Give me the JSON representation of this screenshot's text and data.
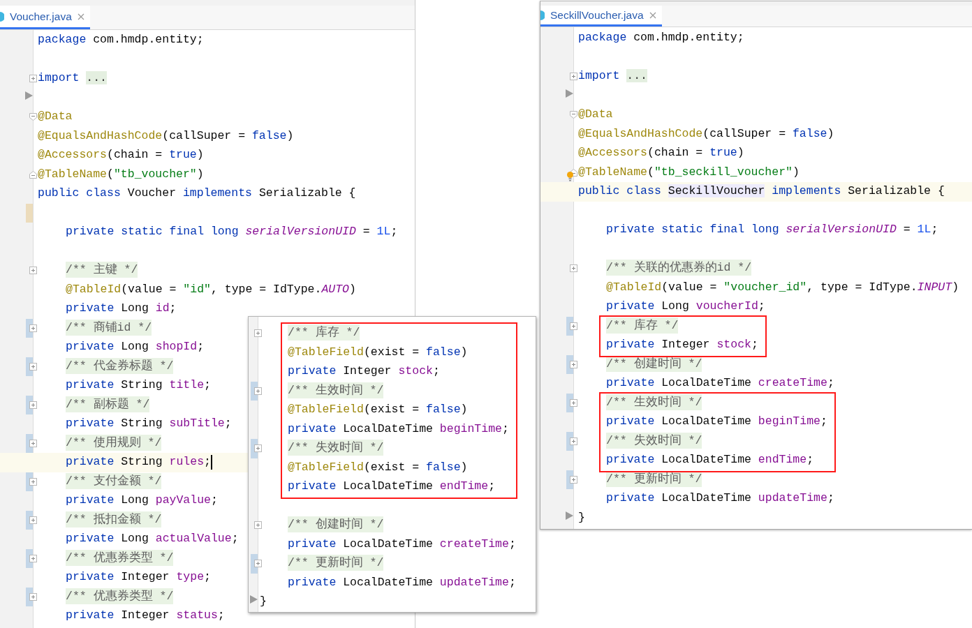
{
  "panels": [
    {
      "kind": "editor",
      "tab": {
        "label": "Voucher.java",
        "selected": true
      },
      "header_lines": [
        {
          "kind": "code",
          "tokens": [
            {
              "kind": "keyword",
              "text": "package"
            },
            {
              "kind": "plain",
              "text": " com.hmdp.entity;"
            }
          ]
        },
        {
          "kind": "blank"
        },
        {
          "kind": "code",
          "collapsed": true,
          "tokens": [
            {
              "kind": "keyword",
              "text": "import "
            },
            {
              "kind": "folded",
              "text": "..."
            }
          ]
        },
        {
          "kind": "blank",
          "arrow": true
        },
        {
          "kind": "code",
          "fold_start": true,
          "tokens": [
            {
              "kind": "annotation",
              "text": "@Data"
            }
          ]
        },
        {
          "kind": "code",
          "tokens": [
            {
              "kind": "annotation",
              "text": "@EqualsAndHashCode"
            },
            {
              "kind": "plain",
              "text": "(callSuper = "
            },
            {
              "kind": "keyword",
              "text": "false"
            },
            {
              "kind": "plain",
              "text": ")"
            }
          ]
        },
        {
          "kind": "code",
          "tokens": [
            {
              "kind": "annotation",
              "text": "@Accessors"
            },
            {
              "kind": "plain",
              "text": "(chain = "
            },
            {
              "kind": "keyword",
              "text": "true"
            },
            {
              "kind": "plain",
              "text": ")"
            }
          ]
        },
        {
          "kind": "code",
          "fold_end": true,
          "tokens": [
            {
              "kind": "annotation",
              "text": "@TableName"
            },
            {
              "kind": "plain",
              "text": "("
            },
            {
              "kind": "string",
              "text": "\"tb_voucher\""
            },
            {
              "kind": "plain",
              "text": ")"
            }
          ]
        },
        {
          "kind": "code",
          "tokens": [
            {
              "kind": "keyword",
              "text": "public class"
            },
            {
              "kind": "plain",
              "text": " Voucher "
            },
            {
              "kind": "keyword",
              "text": "implements"
            },
            {
              "kind": "plain",
              "text": " Serializable {"
            }
          ]
        }
      ],
      "body_lines": [
        {
          "kind": "blank",
          "unsaved": true
        },
        {
          "kind": "code",
          "tokens": [
            {
              "kind": "keyword",
              "text": "private static final long "
            },
            {
              "kind": "static",
              "text": "serialVersionUID"
            },
            {
              "kind": "plain",
              "text": " = "
            },
            {
              "kind": "number",
              "text": "1L"
            },
            {
              "kind": "plain",
              "text": ";"
            }
          ]
        },
        {
          "kind": "blank"
        },
        {
          "kind": "code",
          "collapsed": true,
          "tokens": [
            {
              "kind": "comment",
              "text": "/** 主键 */"
            }
          ]
        },
        {
          "kind": "code",
          "tokens": [
            {
              "kind": "annotation",
              "text": "@TableId"
            },
            {
              "kind": "plain",
              "text": "(value = "
            },
            {
              "kind": "string",
              "text": "\"id\""
            },
            {
              "kind": "plain",
              "text": ", type = IdType."
            },
            {
              "kind": "static",
              "text": "AUTO"
            },
            {
              "kind": "plain",
              "text": ")"
            }
          ]
        },
        {
          "kind": "code",
          "tokens": [
            {
              "kind": "keyword",
              "text": "private"
            },
            {
              "kind": "plain",
              "text": " Long "
            },
            {
              "kind": "field",
              "text": "id"
            },
            {
              "kind": "plain",
              "text": ";"
            }
          ]
        },
        {
          "kind": "code",
          "collapsed": true,
          "changed": true,
          "tokens": [
            {
              "kind": "comment",
              "text": "/** 商铺id */"
            }
          ]
        },
        {
          "kind": "code",
          "tokens": [
            {
              "kind": "keyword",
              "text": "private"
            },
            {
              "kind": "plain",
              "text": " Long "
            },
            {
              "kind": "field",
              "text": "shopId"
            },
            {
              "kind": "plain",
              "text": ";"
            }
          ]
        },
        {
          "kind": "code",
          "collapsed": true,
          "changed": true,
          "tokens": [
            {
              "kind": "comment",
              "text": "/** 代金券标题 */"
            }
          ]
        },
        {
          "kind": "code",
          "tokens": [
            {
              "kind": "keyword",
              "text": "private"
            },
            {
              "kind": "plain",
              "text": " String "
            },
            {
              "kind": "field",
              "text": "title"
            },
            {
              "kind": "plain",
              "text": ";"
            }
          ]
        },
        {
          "kind": "code",
          "collapsed": true,
          "changed": true,
          "tokens": [
            {
              "kind": "comment",
              "text": "/** 副标题 */"
            }
          ]
        },
        {
          "kind": "code",
          "tokens": [
            {
              "kind": "keyword",
              "text": "private"
            },
            {
              "kind": "plain",
              "text": " String "
            },
            {
              "kind": "field",
              "text": "subTitle"
            },
            {
              "kind": "plain",
              "text": ";"
            }
          ]
        },
        {
          "kind": "code",
          "collapsed": true,
          "changed": true,
          "tokens": [
            {
              "kind": "comment",
              "text": "/** 使用规则 */"
            }
          ]
        },
        {
          "kind": "code",
          "current": true,
          "caret": true,
          "tokens": [
            {
              "kind": "keyword",
              "text": "private"
            },
            {
              "kind": "plain",
              "text": " String "
            },
            {
              "kind": "field",
              "text": "rules"
            },
            {
              "kind": "plain",
              "text": ";"
            }
          ]
        },
        {
          "kind": "code",
          "collapsed": true,
          "changed": true,
          "tokens": [
            {
              "kind": "comment",
              "text": "/** 支付金额 */"
            }
          ]
        },
        {
          "kind": "code",
          "tokens": [
            {
              "kind": "keyword",
              "text": "private"
            },
            {
              "kind": "plain",
              "text": " Long "
            },
            {
              "kind": "field",
              "text": "payValue"
            },
            {
              "kind": "plain",
              "text": ";"
            }
          ]
        },
        {
          "kind": "code",
          "collapsed": true,
          "changed": true,
          "tokens": [
            {
              "kind": "comment",
              "text": "/** 抵扣金额 */"
            }
          ]
        },
        {
          "kind": "code",
          "tokens": [
            {
              "kind": "keyword",
              "text": "private"
            },
            {
              "kind": "plain",
              "text": " Long "
            },
            {
              "kind": "field",
              "text": "actualValue"
            },
            {
              "kind": "plain",
              "text": ";"
            }
          ]
        },
        {
          "kind": "code",
          "collapsed": true,
          "changed": true,
          "tokens": [
            {
              "kind": "comment",
              "text": "/** 优惠券类型 */"
            }
          ]
        },
        {
          "kind": "code",
          "tokens": [
            {
              "kind": "keyword",
              "text": "private"
            },
            {
              "kind": "plain",
              "text": " Integer "
            },
            {
              "kind": "field",
              "text": "type"
            },
            {
              "kind": "plain",
              "text": ";"
            }
          ]
        },
        {
          "kind": "code",
          "collapsed": true,
          "changed": true,
          "tokens": [
            {
              "kind": "comment",
              "text": "/** 优惠券类型 */"
            }
          ]
        },
        {
          "kind": "code",
          "tokens": [
            {
              "kind": "keyword",
              "text": "private"
            },
            {
              "kind": "plain",
              "text": " Integer "
            },
            {
              "kind": "field",
              "text": "status"
            },
            {
              "kind": "plain",
              "text": ";"
            }
          ]
        }
      ]
    },
    {
      "kind": "popup",
      "body_lines": [
        {
          "kind": "highlight",
          "children": [
            {
              "kind": "code",
              "collapsed": true,
              "tokens": [
                {
                  "kind": "comment",
                  "text": "/** 库存 */"
                }
              ]
            },
            {
              "kind": "code",
              "tokens": [
                {
                  "kind": "annotation",
                  "text": "@TableField"
                },
                {
                  "kind": "plain",
                  "text": "(exist = "
                },
                {
                  "kind": "keyword",
                  "text": "false"
                },
                {
                  "kind": "plain",
                  "text": ")"
                }
              ]
            },
            {
              "kind": "code",
              "tokens": [
                {
                  "kind": "keyword",
                  "text": "private"
                },
                {
                  "kind": "plain",
                  "text": " Integer "
                },
                {
                  "kind": "field",
                  "text": "stock"
                },
                {
                  "kind": "plain",
                  "text": ";"
                }
              ]
            },
            {
              "kind": "code",
              "collapsed": true,
              "changed": true,
              "tokens": [
                {
                  "kind": "comment",
                  "text": "/** 生效时间 */"
                }
              ]
            },
            {
              "kind": "code",
              "tokens": [
                {
                  "kind": "annotation",
                  "text": "@TableField"
                },
                {
                  "kind": "plain",
                  "text": "(exist = "
                },
                {
                  "kind": "keyword",
                  "text": "false"
                },
                {
                  "kind": "plain",
                  "text": ")"
                }
              ]
            },
            {
              "kind": "code",
              "tokens": [
                {
                  "kind": "keyword",
                  "text": "private"
                },
                {
                  "kind": "plain",
                  "text": " LocalDateTime "
                },
                {
                  "kind": "field",
                  "text": "beginTime"
                },
                {
                  "kind": "plain",
                  "text": ";"
                }
              ]
            },
            {
              "kind": "code",
              "collapsed": true,
              "changed": true,
              "tokens": [
                {
                  "kind": "comment",
                  "text": "/** 失效时间 */"
                }
              ]
            },
            {
              "kind": "code",
              "tokens": [
                {
                  "kind": "annotation",
                  "text": "@TableField"
                },
                {
                  "kind": "plain",
                  "text": "(exist = "
                },
                {
                  "kind": "keyword",
                  "text": "false"
                },
                {
                  "kind": "plain",
                  "text": ")"
                }
              ]
            },
            {
              "kind": "code",
              "tokens": [
                {
                  "kind": "keyword",
                  "text": "private"
                },
                {
                  "kind": "plain",
                  "text": " LocalDateTime "
                },
                {
                  "kind": "field",
                  "text": "endTime"
                },
                {
                  "kind": "plain",
                  "text": ";"
                }
              ]
            }
          ]
        },
        {
          "kind": "blank"
        },
        {
          "kind": "code",
          "collapsed": true,
          "tokens": [
            {
              "kind": "comment",
              "text": "/** 创建时间 */"
            }
          ]
        },
        {
          "kind": "code",
          "tokens": [
            {
              "kind": "keyword",
              "text": "private"
            },
            {
              "kind": "plain",
              "text": " LocalDateTime "
            },
            {
              "kind": "field",
              "text": "createTime"
            },
            {
              "kind": "plain",
              "text": ";"
            }
          ]
        },
        {
          "kind": "code",
          "collapsed": true,
          "changed": true,
          "tokens": [
            {
              "kind": "comment",
              "text": "/** 更新时间 */"
            }
          ]
        },
        {
          "kind": "code",
          "tokens": [
            {
              "kind": "keyword",
              "text": "private"
            },
            {
              "kind": "plain",
              "text": " LocalDateTime "
            },
            {
              "kind": "field",
              "text": "updateTime"
            },
            {
              "kind": "plain",
              "text": ";"
            }
          ]
        }
      ],
      "footer_lines": [
        {
          "kind": "code",
          "arrow": true,
          "tokens": [
            {
              "kind": "plain",
              "text": "}"
            }
          ]
        }
      ]
    },
    {
      "kind": "editor",
      "tab": {
        "label": "SeckillVoucher.java",
        "selected": true
      },
      "header_lines": [
        {
          "kind": "code",
          "tokens": [
            {
              "kind": "keyword",
              "text": "package"
            },
            {
              "kind": "plain",
              "text": " com.hmdp.entity;"
            }
          ]
        },
        {
          "kind": "blank"
        },
        {
          "kind": "code",
          "collapsed": true,
          "tokens": [
            {
              "kind": "keyword",
              "text": "import "
            },
            {
              "kind": "folded",
              "text": "..."
            }
          ]
        },
        {
          "kind": "blank",
          "arrow": true
        },
        {
          "kind": "code",
          "fold_start": true,
          "tokens": [
            {
              "kind": "annotation",
              "text": "@Data"
            }
          ]
        },
        {
          "kind": "code",
          "tokens": [
            {
              "kind": "annotation",
              "text": "@EqualsAndHashCode"
            },
            {
              "kind": "plain",
              "text": "(callSuper = "
            },
            {
              "kind": "keyword",
              "text": "false"
            },
            {
              "kind": "plain",
              "text": ")"
            }
          ]
        },
        {
          "kind": "code",
          "tokens": [
            {
              "kind": "annotation",
              "text": "@Accessors"
            },
            {
              "kind": "plain",
              "text": "(chain = "
            },
            {
              "kind": "keyword",
              "text": "true"
            },
            {
              "kind": "plain",
              "text": ")"
            }
          ]
        },
        {
          "kind": "code",
          "fold_end": true,
          "bulb": true,
          "tokens": [
            {
              "kind": "annotation",
              "text": "@TableName"
            },
            {
              "kind": "plain",
              "text": "("
            },
            {
              "kind": "string",
              "text": "\"tb_seckill_voucher\""
            },
            {
              "kind": "plain",
              "text": ")"
            }
          ]
        },
        {
          "kind": "code",
          "current": true,
          "tokens": [
            {
              "kind": "keyword",
              "text": "public class "
            },
            {
              "kind": "class-ref",
              "text": "SeckillVoucher"
            },
            {
              "kind": "keyword",
              "text": " implements"
            },
            {
              "kind": "plain",
              "text": " Serializable {"
            }
          ]
        }
      ],
      "body_lines": [
        {
          "kind": "blank"
        },
        {
          "kind": "code",
          "tokens": [
            {
              "kind": "keyword",
              "text": "private static final long "
            },
            {
              "kind": "static",
              "text": "serialVersionUID"
            },
            {
              "kind": "plain",
              "text": " = "
            },
            {
              "kind": "number",
              "text": "1L"
            },
            {
              "kind": "plain",
              "text": ";"
            }
          ]
        },
        {
          "kind": "blank"
        },
        {
          "kind": "code",
          "collapsed": true,
          "tokens": [
            {
              "kind": "comment",
              "text": "/** 关联的优惠券的id */"
            }
          ]
        },
        {
          "kind": "code",
          "tokens": [
            {
              "kind": "annotation",
              "text": "@TableId"
            },
            {
              "kind": "plain",
              "text": "(value = "
            },
            {
              "kind": "string",
              "text": "\"voucher_id\""
            },
            {
              "kind": "plain",
              "text": ", type = IdType."
            },
            {
              "kind": "static",
              "text": "INPUT"
            },
            {
              "kind": "plain",
              "text": ")"
            }
          ]
        },
        {
          "kind": "code",
          "tokens": [
            {
              "kind": "keyword",
              "text": "private"
            },
            {
              "kind": "plain",
              "text": " Long "
            },
            {
              "kind": "field",
              "text": "voucherId"
            },
            {
              "kind": "plain",
              "text": ";"
            }
          ]
        },
        {
          "kind": "highlight",
          "children": [
            {
              "kind": "code",
              "collapsed": true,
              "changed": true,
              "tokens": [
                {
                  "kind": "comment",
                  "text": "/** 库存 */"
                }
              ]
            },
            {
              "kind": "code",
              "tokens": [
                {
                  "kind": "keyword",
                  "text": "private"
                },
                {
                  "kind": "plain",
                  "text": " Integer "
                },
                {
                  "kind": "field",
                  "text": "stock"
                },
                {
                  "kind": "plain",
                  "text": ";"
                }
              ]
            }
          ]
        },
        {
          "kind": "code",
          "collapsed": true,
          "changed": true,
          "tokens": [
            {
              "kind": "comment",
              "text": "/** 创建时间 */"
            }
          ]
        },
        {
          "kind": "code",
          "tokens": [
            {
              "kind": "keyword",
              "text": "private"
            },
            {
              "kind": "plain",
              "text": " LocalDateTime "
            },
            {
              "kind": "field",
              "text": "createTime"
            },
            {
              "kind": "plain",
              "text": ";"
            }
          ]
        },
        {
          "kind": "highlight",
          "children": [
            {
              "kind": "code",
              "collapsed": true,
              "changed": true,
              "tokens": [
                {
                  "kind": "comment",
                  "text": "/** 生效时间 */"
                }
              ]
            },
            {
              "kind": "code",
              "tokens": [
                {
                  "kind": "keyword",
                  "text": "private"
                },
                {
                  "kind": "plain",
                  "text": " LocalDateTime "
                },
                {
                  "kind": "field",
                  "text": "beginTime"
                },
                {
                  "kind": "plain",
                  "text": ";"
                }
              ]
            },
            {
              "kind": "code",
              "collapsed": true,
              "changed": true,
              "tokens": [
                {
                  "kind": "comment",
                  "text": "/** 失效时间 */"
                }
              ]
            },
            {
              "kind": "code",
              "tokens": [
                {
                  "kind": "keyword",
                  "text": "private"
                },
                {
                  "kind": "plain",
                  "text": " LocalDateTime "
                },
                {
                  "kind": "field",
                  "text": "endTime"
                },
                {
                  "kind": "plain",
                  "text": ";"
                }
              ]
            }
          ]
        },
        {
          "kind": "code",
          "collapsed": true,
          "changed": true,
          "tokens": [
            {
              "kind": "comment",
              "text": "/** 更新时间 */"
            }
          ]
        },
        {
          "kind": "code",
          "tokens": [
            {
              "kind": "keyword",
              "text": "private"
            },
            {
              "kind": "plain",
              "text": " LocalDateTime "
            },
            {
              "kind": "field",
              "text": "updateTime"
            },
            {
              "kind": "plain",
              "text": ";"
            }
          ]
        }
      ],
      "footer_lines": [
        {
          "kind": "code",
          "arrow": true,
          "tokens": [
            {
              "kind": "plain",
              "text": "}"
            }
          ]
        }
      ]
    }
  ]
}
